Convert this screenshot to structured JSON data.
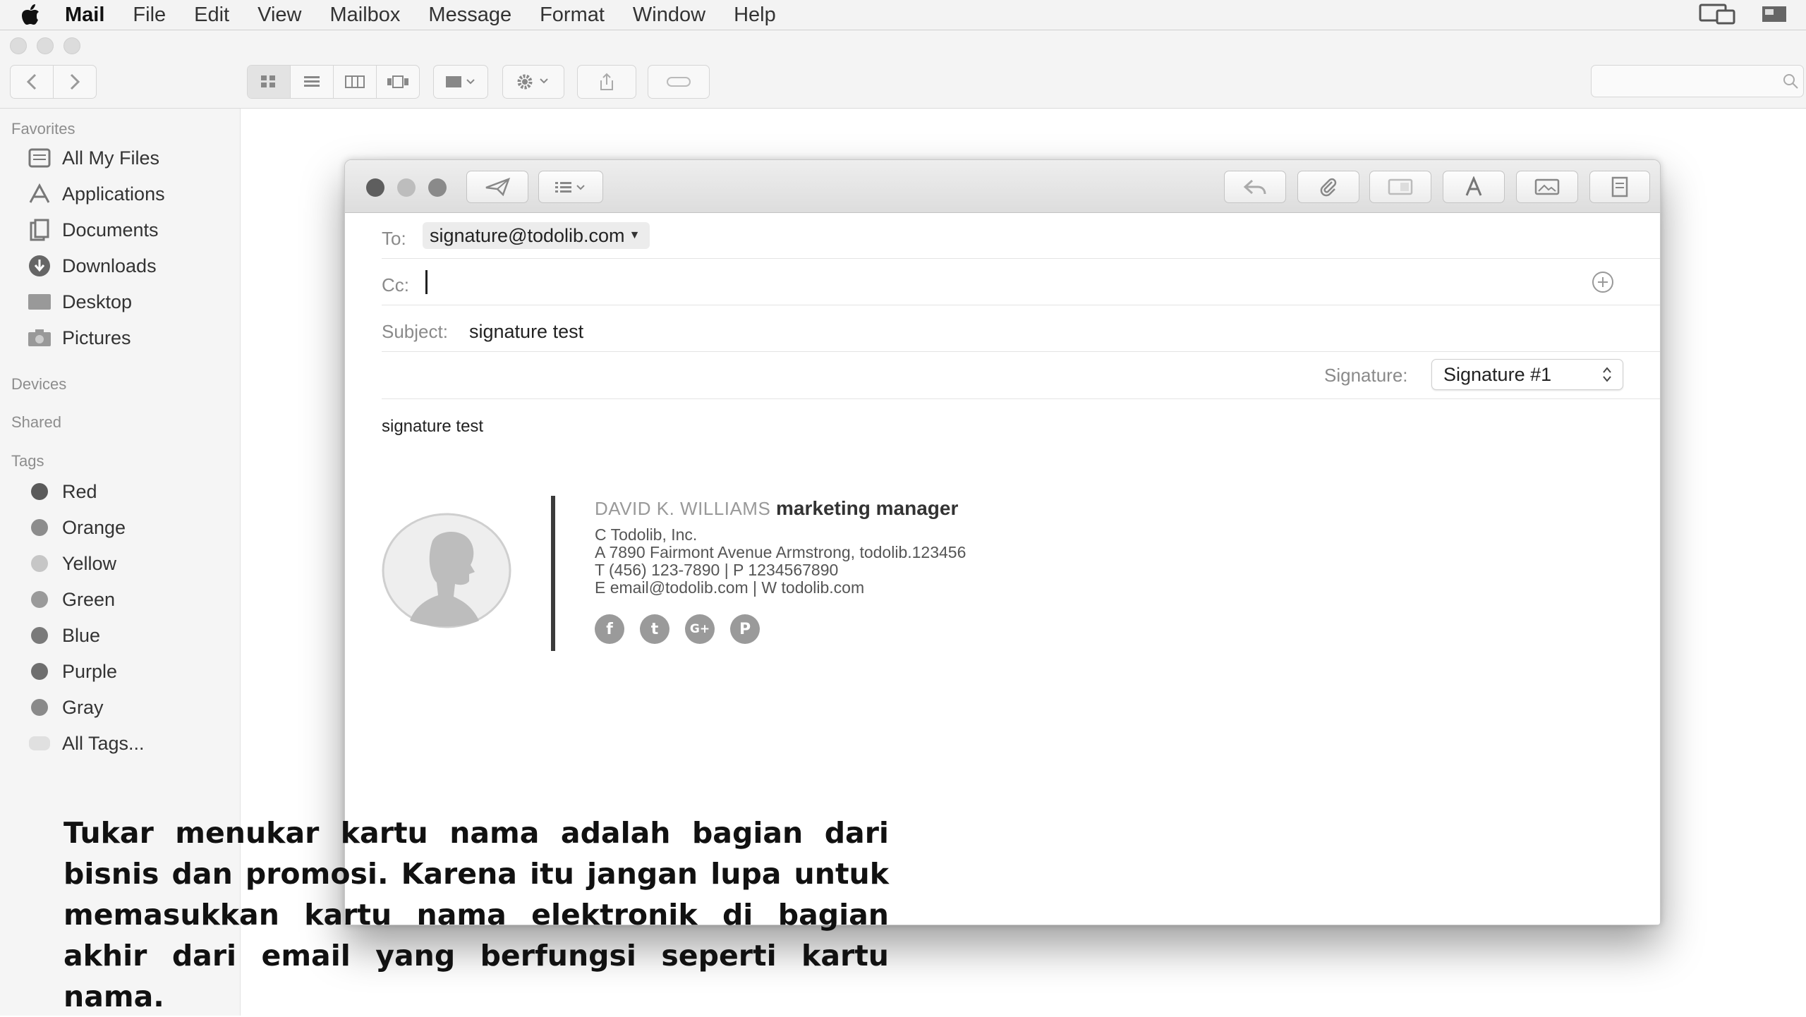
{
  "menubar": {
    "app": "Mail",
    "items": [
      "File",
      "Edit",
      "View",
      "Mailbox",
      "Message",
      "Format",
      "Window",
      "Help"
    ]
  },
  "sidebar": {
    "favorites_header": "Favorites",
    "favorites": [
      {
        "label": "All My Files",
        "icon": "all-files-icon"
      },
      {
        "label": "Applications",
        "icon": "applications-icon"
      },
      {
        "label": "Documents",
        "icon": "documents-icon"
      },
      {
        "label": "Downloads",
        "icon": "downloads-icon"
      },
      {
        "label": "Desktop",
        "icon": "desktop-icon"
      },
      {
        "label": "Pictures",
        "icon": "pictures-icon"
      }
    ],
    "devices_header": "Devices",
    "shared_header": "Shared",
    "tags_header": "Tags",
    "tags": [
      {
        "label": "Red",
        "color": "#5a5a5a"
      },
      {
        "label": "Orange",
        "color": "#8c8c8c"
      },
      {
        "label": "Yellow",
        "color": "#c6c6c6"
      },
      {
        "label": "Green",
        "color": "#9a9a9a"
      },
      {
        "label": "Blue",
        "color": "#7a7a7a"
      },
      {
        "label": "Purple",
        "color": "#6e6e6e"
      },
      {
        "label": "Gray",
        "color": "#8a8a8a"
      },
      {
        "label": "All Tags...",
        "color": "#e0e0e0"
      }
    ]
  },
  "compose": {
    "to_label": "To:",
    "to_value": "signature@todolib.com",
    "cc_label": "Cc:",
    "subject_label": "Subject:",
    "subject_value": "signature test",
    "signature_label": "Signature:",
    "signature_value": "Signature #1",
    "body_text": "signature test",
    "signature_card": {
      "name": "DAVID K. WILLIAMS",
      "role": "marketing manager",
      "company": "C Todolib, Inc.",
      "address": "A 7890 Fairmont Avenue Armstrong, todolib.123456",
      "phone": "T (456) 123-7890 | P 1234567890",
      "email": "E email@todolib.com | W todolib.com",
      "social": [
        "f",
        "t",
        "G+",
        "P"
      ]
    }
  },
  "caption": "Tukar menukar kartu nama adalah bagian dari bisnis dan promosi. Karena itu jangan lupa untuk memasukkan kartu nama elektronik di bagian akhir dari email yang berfungsi seperti kartu nama.",
  "colors": {
    "close": "#5e5e5e",
    "minimize": "#bdbdbd",
    "zoom": "#8a8a8a"
  }
}
